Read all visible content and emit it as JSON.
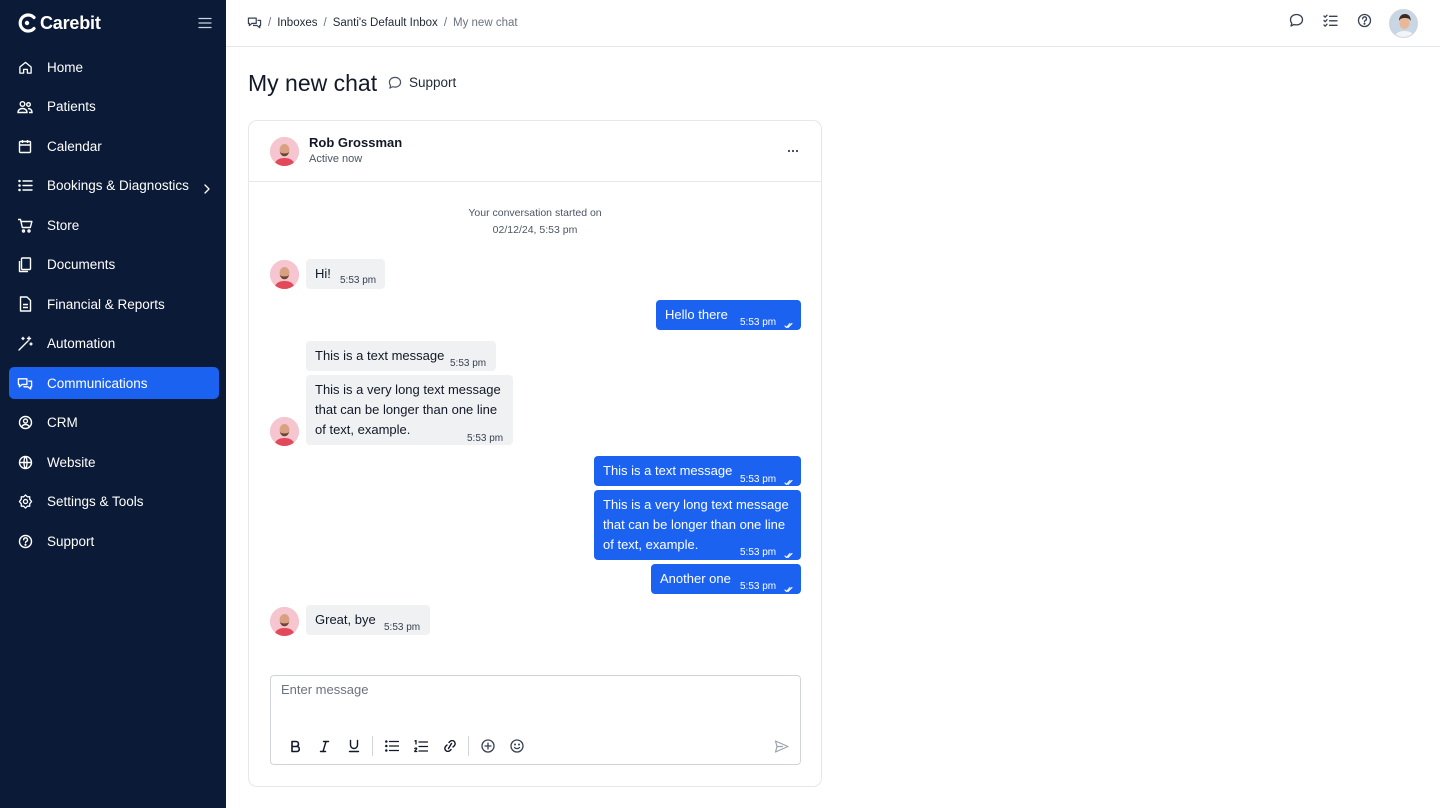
{
  "brand": {
    "name": "Carebit"
  },
  "sidebar": {
    "items": [
      {
        "label": "Home",
        "icon": "home-icon",
        "active": false
      },
      {
        "label": "Patients",
        "icon": "users-icon",
        "active": false
      },
      {
        "label": "Calendar",
        "icon": "calendar-icon",
        "active": false
      },
      {
        "label": "Bookings & Diagnostics",
        "icon": "list-icon",
        "active": false,
        "has_submenu": true
      },
      {
        "label": "Store",
        "icon": "cart-icon",
        "active": false
      },
      {
        "label": "Documents",
        "icon": "documents-icon",
        "active": false
      },
      {
        "label": "Financial & Reports",
        "icon": "report-icon",
        "active": false
      },
      {
        "label": "Automation",
        "icon": "wand-icon",
        "active": false
      },
      {
        "label": "Communications",
        "icon": "chat-icon",
        "active": true
      },
      {
        "label": "CRM",
        "icon": "crm-icon",
        "active": false
      },
      {
        "label": "Website",
        "icon": "globe-icon",
        "active": false
      },
      {
        "label": "Settings & Tools",
        "icon": "gear-icon",
        "active": false
      },
      {
        "label": "Support",
        "icon": "help-icon",
        "active": false
      }
    ]
  },
  "breadcrumb": {
    "items": [
      "Inboxes",
      "Santi's Default Inbox"
    ],
    "current": "My new chat"
  },
  "page": {
    "title": "My new chat",
    "tag": "Support"
  },
  "chat": {
    "contact_name": "Rob Grossman",
    "contact_status": "Active now",
    "started_line1": "Your conversation started on",
    "started_line2": "02/12/24, 5:53 pm",
    "messages": [
      {
        "dir": "in",
        "text": "Hi!",
        "time": "5:53 pm"
      },
      {
        "dir": "out",
        "text": "Hello there",
        "time": "5:53 pm"
      },
      {
        "dir": "in",
        "text": "This is a text message",
        "time": "5:53 pm"
      },
      {
        "dir": "in",
        "text": "This is a very long text message that can be longer than one line of text, example.",
        "time": "5:53 pm"
      },
      {
        "dir": "out",
        "text": "This is a text message",
        "time": "5:53 pm"
      },
      {
        "dir": "out",
        "text": "This is a very long text message that can be longer than one line of text, example.",
        "time": "5:53 pm"
      },
      {
        "dir": "out",
        "text": "Another one",
        "time": "5:53 pm"
      },
      {
        "dir": "in",
        "text": "Great, bye",
        "time": "5:53 pm"
      }
    ]
  },
  "composer": {
    "placeholder": "Enter message",
    "value": ""
  },
  "colors": {
    "sidebar_bg": "#0b1a36",
    "accent": "#1b62f1",
    "incoming_bubble": "#f0f1f3"
  }
}
